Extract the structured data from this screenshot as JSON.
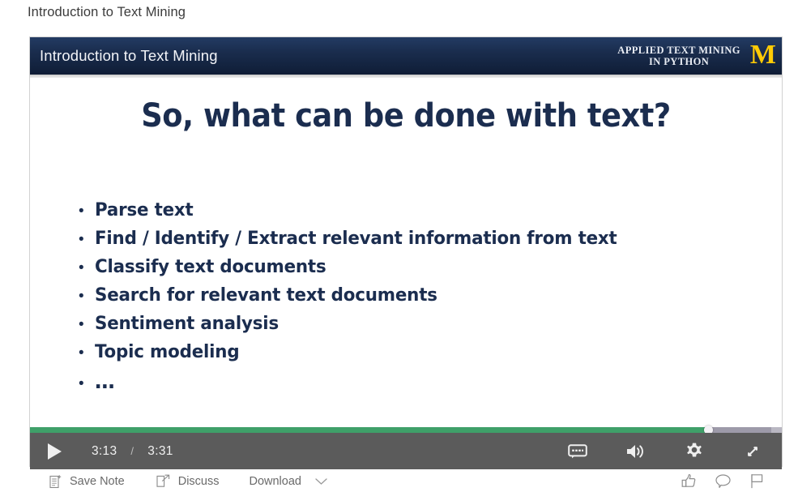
{
  "page": {
    "title": "Introduction to Text Mining"
  },
  "slide": {
    "header_title": "Introduction to Text Mining",
    "brand_line1": "APPLIED TEXT MINING",
    "brand_line2": "IN PYTHON",
    "brand_logo": "M",
    "title": "So, what can be done with text?",
    "bullet_marker": "•",
    "bullets": [
      {
        "text": "Parse text"
      },
      {
        "text": "Find / Identify / Extract relevant information from text"
      },
      {
        "text": "Classify text documents"
      },
      {
        "text": "Search for relevant text documents"
      },
      {
        "text": "Sentiment analysis"
      },
      {
        "text": "Topic modeling"
      },
      {
        "text": "…"
      }
    ]
  },
  "player": {
    "play_label": "play-icon",
    "current_time": "3:13",
    "separator": "/",
    "duration": "3:31",
    "progress_percent": 90.2,
    "buffer_percent": 98.6,
    "controls": [
      {
        "name": "subtitles-icon",
        "label": "Subtitles"
      },
      {
        "name": "volume-icon",
        "label": "Volume"
      },
      {
        "name": "settings-gear-icon",
        "label": "Settings"
      },
      {
        "name": "fullscreen-icon",
        "label": "Fullscreen"
      }
    ],
    "colors": {
      "progress_played": "#3fa069",
      "progress_buffer": "#9d9aa9",
      "progress_track": "#b9b7c2",
      "control_bar": "#5b5b5b",
      "header_navy": "#1a2d4e",
      "brand_maize": "#FFCB05",
      "slide_text_navy": "#1b2d4f"
    }
  },
  "toolbar": {
    "save_note_label": "Save Note",
    "discuss_label": "Discuss",
    "download_label": "Download",
    "reactions": [
      {
        "name": "thumbs-up-icon"
      },
      {
        "name": "comment-bubble-icon"
      },
      {
        "name": "flag-icon"
      }
    ]
  }
}
